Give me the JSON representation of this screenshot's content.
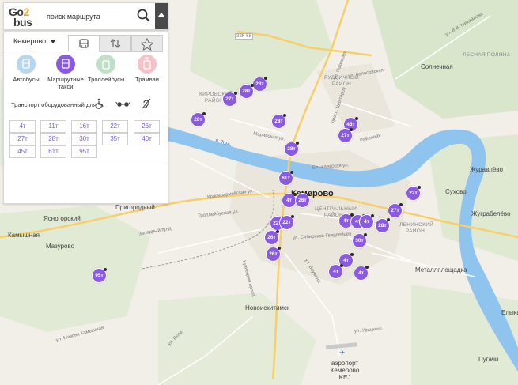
{
  "logo": {
    "line1_prefix": "Go",
    "line1_accent": "2",
    "line2": "bus"
  },
  "search": {
    "placeholder": "поиск маршрута"
  },
  "colors": {
    "accent": "#8a5ae0",
    "bus": "#b8d6ef",
    "trolleybus": "#bfe0c6",
    "tram": "#f6c2c6"
  },
  "panel": {
    "city": "Кемерово",
    "tabs": [
      {
        "icon": "bus-front-icon"
      },
      {
        "icon": "swap-arrows-icon"
      },
      {
        "icon": "star-icon"
      }
    ],
    "transport_types": [
      {
        "label": "Автобусы",
        "icon": "bus-icon",
        "selected": false
      },
      {
        "label": "Маршрутные такси",
        "icon": "minibus-icon",
        "selected": true
      },
      {
        "label": "Троллейбусы",
        "icon": "trolleybus-icon",
        "selected": false
      },
      {
        "label": "Трамваи",
        "icon": "tram-icon",
        "selected": false
      }
    ],
    "equipment_title": "Транспорт оборудованный для",
    "equipment_icons": [
      "wheelchair-icon",
      "glasses-icon",
      "hearing-icon"
    ],
    "routes": [
      "4т",
      "11т",
      "16т",
      "22т",
      "26т",
      "27т",
      "28т",
      "30т",
      "35т",
      "40т",
      "45т",
      "61т",
      "95т"
    ]
  },
  "map": {
    "places": {
      "solnechnaya": "Солнечная",
      "lesnaya_polyana": "ЛЕСНАЯ ПОЛЯНА",
      "rudnichny": "РУДНИЧНЫЙ РАЙОН",
      "kirovsky": "КИРОВСКИЙ РАЙОН",
      "kemerovo": "Кемерово",
      "central": "ЦЕНТРАЛЬНЫЙ РАЙОН",
      "leninsky": "ЛЕНИНСКИЙ РАЙОН",
      "zhuravlevo": "Журавлёво",
      "sukhovo": "Сухово",
      "yugravlevo": "Жуграбелёво",
      "prigorodny": "Пригородный",
      "yasnogorsky": "Ясногорский",
      "kamyshnaya": "Камышная",
      "mazurovo": "Мазурово",
      "metallploshchadka": "Металлплощадка",
      "novoiskitimsk": "Новоискитимск",
      "elykaeva": "Елыка",
      "airport": "аэропорт Кемерово KEJ",
      "pugachi": "Пугачи"
    },
    "streets": {
      "nazimova": "ул. Назимова",
      "shakhtyorov": "просп. Шахтёров",
      "rayonnaya": "Районная",
      "elykaevskaya": "Елыкаевская ул.",
      "krasnoarmeyskaya": "Красноармейская ул.",
      "mariinskaya": "Марийская ул.",
      "troleybusnaya": "Троллейбусная ул.",
      "zapadny": "Западный пр-д",
      "sibiryakov": "ул. Сибиряков-Гвардейцев",
      "kuznetsky": "Кузнецкий просп.",
      "baumana": "ул. Баумана",
      "kolosovskaya": "ул. Колосовская",
      "v_mikhailova": "ул. В.В. Михайлова",
      "mazova": "ул. Мазова Камышная",
      "vezd": "ул. Вела",
      "road": "32К-68",
      "tom": "р. Томь",
      "uritskogo": "ул. Урицкого"
    },
    "pins": [
      {
        "label": "28т"
      },
      {
        "label": "28т"
      },
      {
        "label": "27т"
      },
      {
        "label": "28т"
      },
      {
        "label": "28т"
      },
      {
        "label": "45т"
      },
      {
        "label": "27т"
      },
      {
        "label": "28т"
      },
      {
        "label": "61т"
      },
      {
        "label": "4т"
      },
      {
        "label": "26т"
      },
      {
        "label": "22т"
      },
      {
        "label": "22т"
      },
      {
        "label": "22т"
      },
      {
        "label": "27т"
      },
      {
        "label": "26т"
      },
      {
        "label": "4т"
      },
      {
        "label": "4т"
      },
      {
        "label": "4т"
      },
      {
        "label": "28т"
      },
      {
        "label": "30т"
      },
      {
        "label": "26т"
      },
      {
        "label": "4т"
      },
      {
        "label": "4т"
      },
      {
        "label": "4т"
      },
      {
        "label": "95т"
      }
    ]
  }
}
